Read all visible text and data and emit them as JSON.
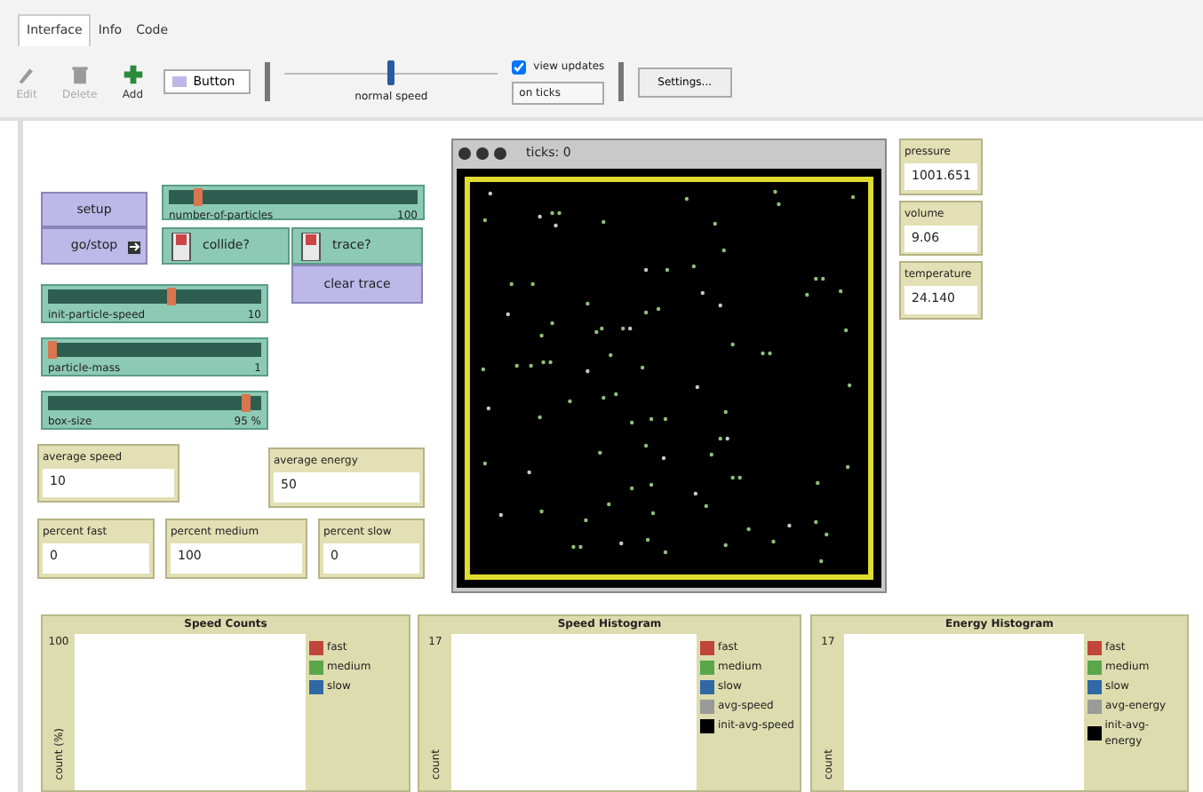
{
  "tabs": [
    {
      "label": "Interface",
      "selected": true
    },
    {
      "label": "Info",
      "selected": false
    },
    {
      "label": "Code",
      "selected": false
    }
  ],
  "toolbar": {
    "tools": [
      {
        "kind": "edit",
        "label": "Edit",
        "disabled": true
      },
      {
        "kind": "delete",
        "label": "Delete",
        "disabled": true
      },
      {
        "kind": "add",
        "label": "Add",
        "disabled": false
      }
    ],
    "widget_menu": "Button",
    "speed": {
      "label": "normal speed",
      "level": 0.5
    },
    "view_updates": {
      "label": "view updates",
      "checked": true
    },
    "update_mode": "on ticks",
    "settings": "Settings..."
  },
  "buttons": [
    {
      "label": "setup",
      "forever": false
    },
    {
      "label": "go/stop",
      "forever": true
    },
    {
      "label": "clear trace",
      "forever": false
    }
  ],
  "sliders": [
    {
      "name": "number-of-particles",
      "value": "100",
      "level": 0.1
    },
    {
      "name": "init-particle-speed",
      "value": "10",
      "level": 0.58
    },
    {
      "name": "particle-mass",
      "value": "1",
      "level": 0.0
    },
    {
      "name": "box-size",
      "value": "95 %",
      "level": 0.95
    }
  ],
  "switches": [
    {
      "name": "collide?",
      "on": true
    },
    {
      "name": "trace?",
      "on": true
    }
  ],
  "monitors": [
    {
      "label": "average speed",
      "value": "10"
    },
    {
      "label": "average energy",
      "value": "50"
    },
    {
      "label": "percent fast",
      "value": "0"
    },
    {
      "label": "percent medium",
      "value": "100"
    },
    {
      "label": "percent slow",
      "value": "0"
    },
    {
      "label": "pressure",
      "value": "1001.651"
    },
    {
      "label": "volume",
      "value": "9.06"
    },
    {
      "label": "temperature",
      "value": "24.140"
    }
  ],
  "view": {
    "title": "ticks: 0"
  },
  "plots": [
    {
      "title": "Speed Counts",
      "y_max": "100",
      "ylabel": "count (%)",
      "legend": [
        {
          "label": "fast",
          "color": "#c0453a"
        },
        {
          "label": "medium",
          "color": "#5aa64a"
        },
        {
          "label": "slow",
          "color": "#2f68a3"
        }
      ]
    },
    {
      "title": "Speed Histogram",
      "y_max": "17",
      "ylabel": "count",
      "legend": [
        {
          "label": "fast",
          "color": "#c0453a"
        },
        {
          "label": "medium",
          "color": "#5aa64a"
        },
        {
          "label": "slow",
          "color": "#2f68a3"
        },
        {
          "label": "avg-speed",
          "color": "#9a9a9a"
        },
        {
          "label": "init-avg-speed",
          "color": "#000000"
        }
      ]
    },
    {
      "title": "Energy Histogram",
      "y_max": "17",
      "ylabel": "count",
      "legend": [
        {
          "label": "fast",
          "color": "#c0453a"
        },
        {
          "label": "medium",
          "color": "#5aa64a"
        },
        {
          "label": "slow",
          "color": "#2f68a3"
        },
        {
          "label": "avg-energy",
          "color": "#9a9a9a"
        },
        {
          "label": "init-avg-energy",
          "color": "#000000"
        }
      ]
    }
  ]
}
